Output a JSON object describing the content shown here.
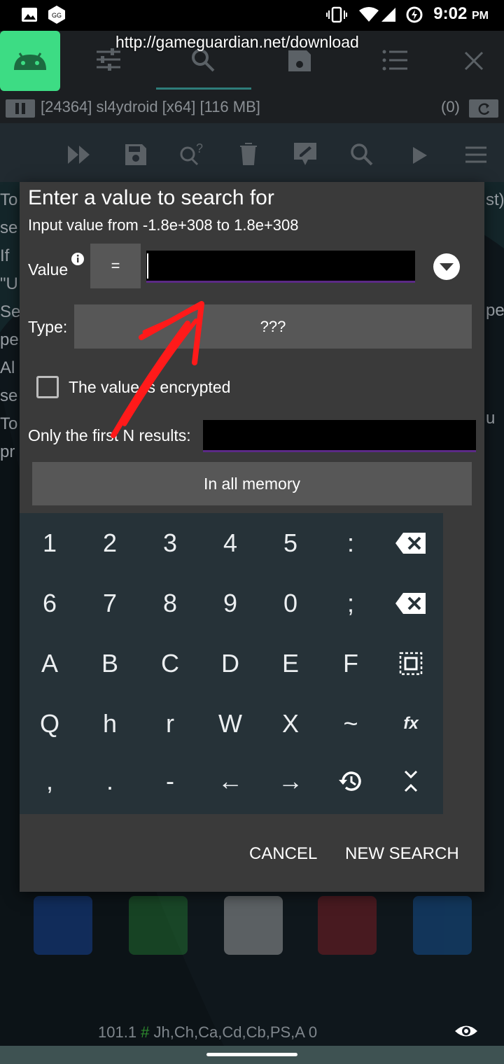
{
  "status_bar": {
    "time": "9:02",
    "ampm": "PM"
  },
  "app": {
    "url": "http://gameguardian.net/download",
    "process": "[24364] sl4ydroid [x64] [116 MB]",
    "results_count": "(0)"
  },
  "background_text": [
    "To",
    "se",
    "If",
    "\"U",
    "Se",
    "pe",
    "Al",
    "se",
    "To",
    "pr"
  ],
  "background_text_right": [
    "st)",
    "pe",
    "u"
  ],
  "dialog": {
    "title": "Enter a value to search for",
    "subtitle": "Input value from -1.8e+308 to 1.8e+308",
    "value_label": "Value",
    "eq_label": "=",
    "value_input": "",
    "type_label": "Type:",
    "type_value": "???",
    "encrypted_label": "The value is encrypted",
    "first_n_label": "Only the first N results:",
    "first_n_value": "",
    "memory_button": "In all memory",
    "cancel": "CANCEL",
    "new_search": "NEW SEARCH"
  },
  "keyboard": {
    "rows": [
      [
        "1",
        "2",
        "3",
        "4",
        "5",
        ":"
      ],
      [
        "6",
        "7",
        "8",
        "9",
        "0",
        ";"
      ],
      [
        "A",
        "B",
        "C",
        "D",
        "E",
        "F"
      ],
      [
        "Q",
        "h",
        "r",
        "W",
        "X",
        "~"
      ],
      [
        ",",
        ".",
        "-",
        "←",
        "→"
      ]
    ],
    "fx_label": "fx"
  },
  "footer": {
    "text_prefix": "101.1 ",
    "text_hash": "#",
    "text_suffix": " Jh,Ch,Ca,Cd,Cb,PS,A 0"
  },
  "colors": {
    "accent_underline": "#5b2a86",
    "annotation_arrow": "#ff1a1a"
  }
}
